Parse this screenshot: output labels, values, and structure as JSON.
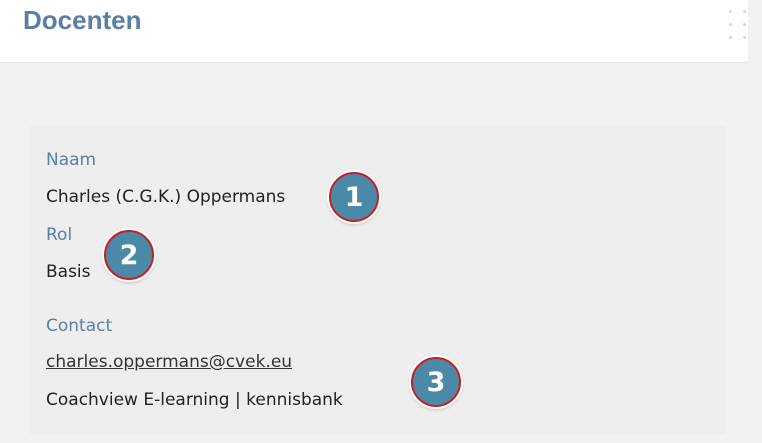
{
  "header": {
    "title": "Docenten"
  },
  "teacher": {
    "name_label": "Naam",
    "name_value": "Charles (C.G.K.) Oppermans",
    "role_label": "Rol",
    "role_value": "Basis",
    "contact_label": "Contact",
    "email": "charles.oppermans@cvek.eu",
    "organization": "Coachview E-learning | kennisbank"
  },
  "callouts": [
    "1",
    "2",
    "3"
  ],
  "colors": {
    "accent_blue": "#5b7ea6",
    "badge_fill": "#4a8aa8",
    "badge_border": "#cc1d1d",
    "card_bg": "#eeeeee"
  }
}
